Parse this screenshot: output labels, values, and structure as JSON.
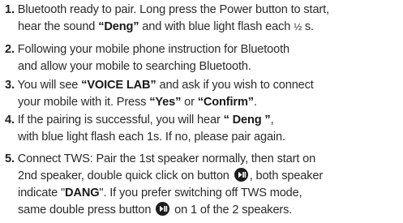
{
  "instructions": {
    "item1": {
      "num": "1.",
      "line1": "Bluetooth ready to pair. Long press the Power button to start,",
      "line2a": "hear the sound ",
      "sound": "“Deng”",
      "line2b": " and with blue light flash each ",
      "half": "½",
      "line2c": " s."
    },
    "item2": {
      "num": "2.",
      "line1": "Following your mobile phone instruction for Bluetooth",
      "line2": "and allow your mobile to searching Bluetooth."
    },
    "item3": {
      "num": "3.",
      "line1a": "You will see ",
      "device": "“VOICE LAB”",
      "line1b": " and ask if you wish to connect",
      "line2a": "your mobile with it. Press ",
      "yes": "“Yes”",
      "or": " or ",
      "confirm": "“Confirm”",
      "line2b": "."
    },
    "item4": {
      "num": "4.",
      "line1a": "If the pairing is successful, you will hear ",
      "sound": "“ Deng ”",
      "line1b": ",",
      "line2": "with blue light flash each 1s. If no, please pair again."
    },
    "item5": {
      "num": "5.",
      "line1": "Connect TWS: Pair the 1st speaker normally, then start on",
      "line2a": "2nd speaker, double quick click on button ",
      "line2b": ", both speaker",
      "line3a": "indicate \"",
      "dang": "DANG",
      "line3b": "\". If you prefer switching off TWS mode,",
      "line4a": "same double press button ",
      "line4b": " on 1 of the 2 speakers."
    }
  },
  "icons": {
    "play_pause": "play-pause-icon"
  },
  "colors": {
    "text": "#2b2b2b",
    "icon": "#1d1d1d"
  }
}
